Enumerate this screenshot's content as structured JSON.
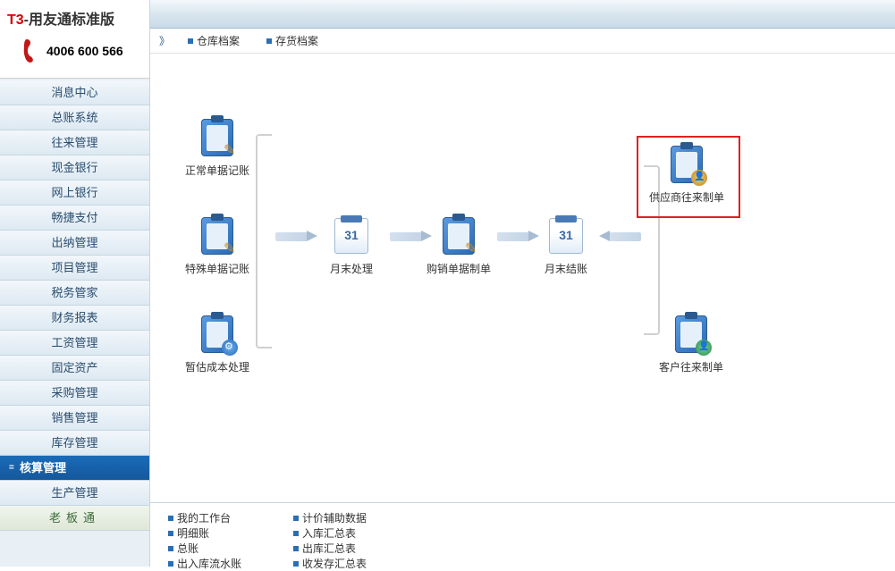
{
  "app": {
    "brand_prefix": "T3",
    "brand_suffix": "-用友通标准版",
    "phone": "4006 600 566"
  },
  "sidebar": {
    "items": [
      {
        "label": "消息中心",
        "active": false
      },
      {
        "label": "总账系统",
        "active": false
      },
      {
        "label": "往来管理",
        "active": false
      },
      {
        "label": "现金银行",
        "active": false
      },
      {
        "label": "网上银行",
        "active": false
      },
      {
        "label": "畅捷支付",
        "active": false
      },
      {
        "label": "出纳管理",
        "active": false
      },
      {
        "label": "项目管理",
        "active": false
      },
      {
        "label": "税务管家",
        "active": false
      },
      {
        "label": "财务报表",
        "active": false
      },
      {
        "label": "工资管理",
        "active": false
      },
      {
        "label": "固定资产",
        "active": false
      },
      {
        "label": "采购管理",
        "active": false
      },
      {
        "label": "销售管理",
        "active": false
      },
      {
        "label": "库存管理",
        "active": false
      },
      {
        "label": "核算管理",
        "active": true
      },
      {
        "label": "生产管理",
        "active": false
      },
      {
        "label": "老板通",
        "active": false,
        "special": true
      }
    ]
  },
  "toolbar": {
    "links": [
      {
        "label": "仓库档案"
      },
      {
        "label": "存货档案"
      }
    ]
  },
  "flow": {
    "nodes": {
      "normal_voucher": "正常单据记账",
      "special_voucher": "特殊单据记账",
      "est_cost": "暂估成本处理",
      "month_end_process": "月末处理",
      "purchase_sale": "购销单据制单",
      "month_end_close": "月末结账",
      "supplier_ar": "供应商往来制单",
      "customer_ar": "客户往来制单"
    }
  },
  "bottom_links": {
    "col1": [
      {
        "label": "我的工作台"
      },
      {
        "label": "明细账"
      },
      {
        "label": "总账"
      },
      {
        "label": "出入库流水账"
      }
    ],
    "col2": [
      {
        "label": "计价辅助数据"
      },
      {
        "label": "入库汇总表"
      },
      {
        "label": "出库汇总表"
      },
      {
        "label": "收发存汇总表"
      }
    ]
  }
}
